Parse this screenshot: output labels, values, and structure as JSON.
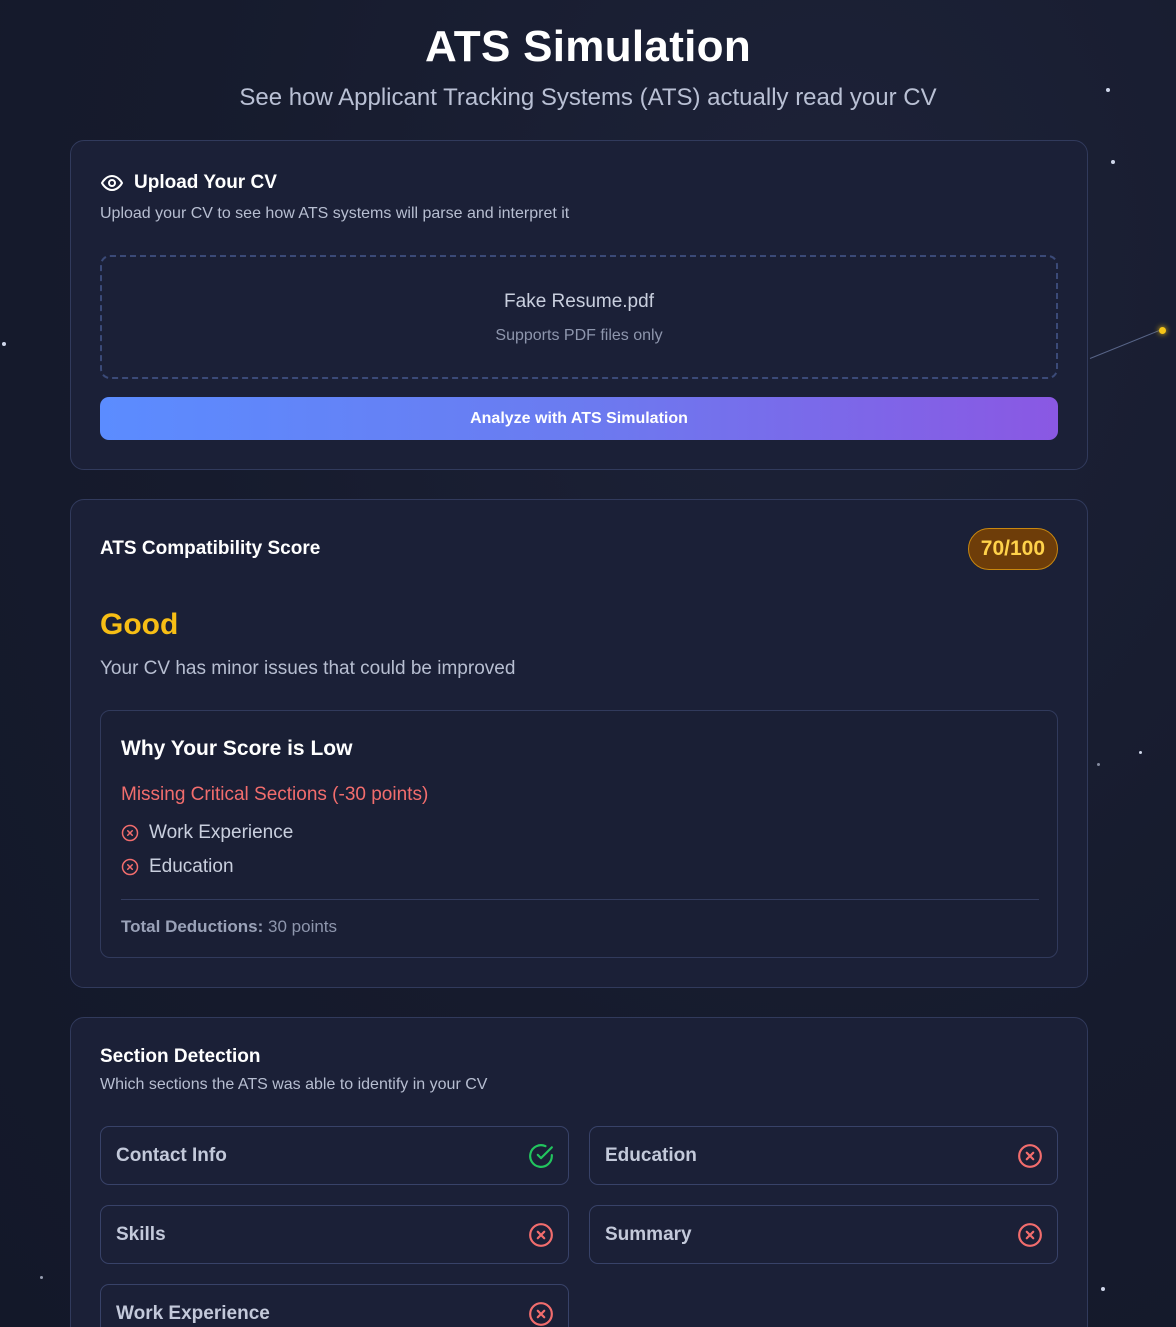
{
  "header": {
    "title": "ATS Simulation",
    "subtitle": "See how Applicant Tracking Systems (ATS) actually read your CV"
  },
  "upload": {
    "title": "Upload Your CV",
    "description": "Upload your CV to see how ATS systems will parse and interpret it",
    "file_name": "Fake Resume.pdf",
    "file_hint": "Supports PDF files only",
    "analyze_label": "Analyze with ATS Simulation",
    "icon": "eye-icon"
  },
  "score": {
    "title": "ATS Compatibility Score",
    "badge": "70/100",
    "value": 70,
    "max": 100,
    "rating": "Good",
    "rating_desc": "Your CV has minor issues that could be improved",
    "why": {
      "title": "Why Your Score is Low",
      "missing_title": "Missing Critical Sections (-30 points)",
      "missing_items": [
        "Work Experience",
        "Education"
      ],
      "total_label": "Total Deductions:",
      "total_value": "30 points"
    }
  },
  "sections": {
    "title": "Section Detection",
    "description": "Which sections the ATS was able to identify in your CV",
    "items": [
      {
        "label": "Contact Info",
        "detected": true
      },
      {
        "label": "Education",
        "detected": false
      },
      {
        "label": "Skills",
        "detected": false
      },
      {
        "label": "Summary",
        "detected": false
      },
      {
        "label": "Work Experience",
        "detected": false
      }
    ]
  },
  "colors": {
    "accent_gradient_start": "#5b8cff",
    "accent_gradient_end": "#8a58e3",
    "rating_color": "#f7be15",
    "error": "#f26d6d",
    "success": "#22c55e"
  }
}
